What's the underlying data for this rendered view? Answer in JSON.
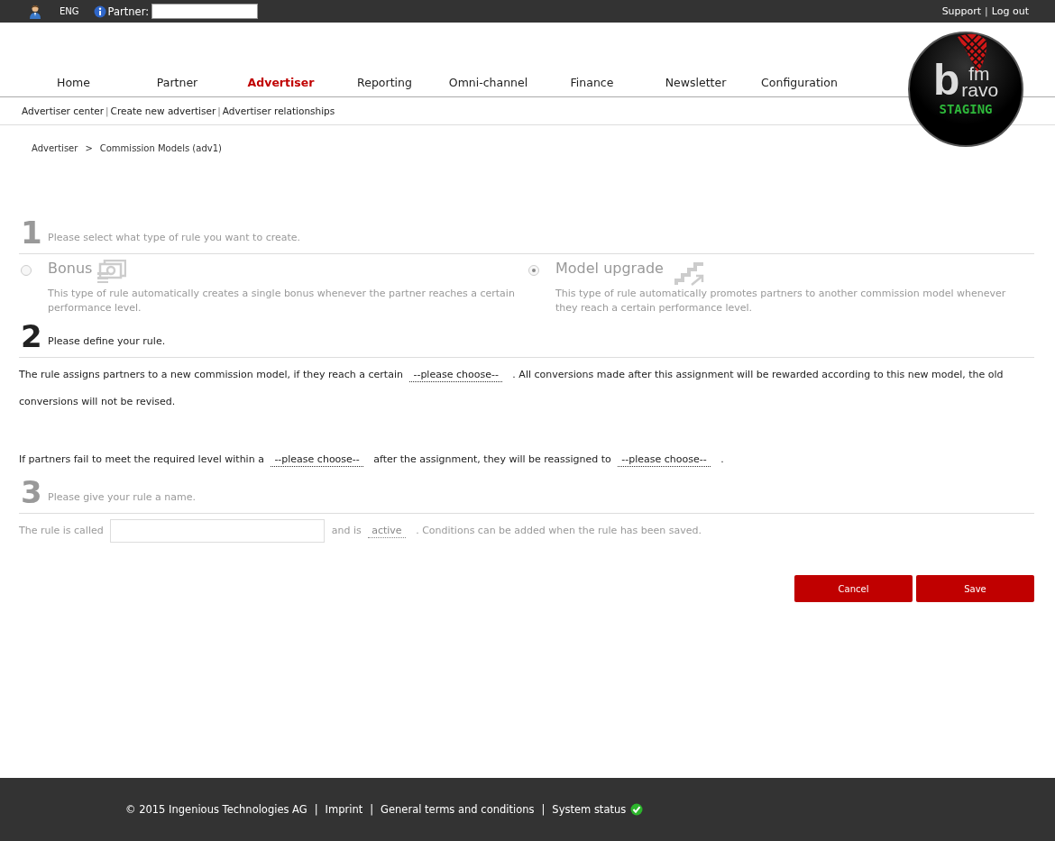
{
  "top_bar": {
    "language": "ENG",
    "partner_label": "Partner:",
    "links": [
      "Support",
      "Log out"
    ],
    "separator": "|"
  },
  "nav": {
    "items": [
      {
        "label": "Home",
        "selected": false
      },
      {
        "label": "Partner",
        "selected": false
      },
      {
        "label": "Advertiser",
        "selected": true
      },
      {
        "label": "Reporting",
        "selected": false
      },
      {
        "label": "Omni-channel",
        "selected": false
      },
      {
        "label": "Finance",
        "selected": false
      },
      {
        "label": "Newsletter",
        "selected": false
      },
      {
        "label": "Configuration",
        "selected": false
      }
    ]
  },
  "logo": {
    "letter": "b",
    "top": "fm",
    "bottom": "ravo",
    "label": "STAGING"
  },
  "subnav": {
    "items": [
      "Advertiser center",
      "Create new advertiser",
      "Advertiser relationships"
    ],
    "separator": "|"
  },
  "breadcrumb": {
    "items": [
      "Advertiser",
      "Commission Models (adv1)"
    ],
    "separator": ">"
  },
  "steps": [
    {
      "number": "1",
      "title": "Please select what type of rule you want to create.",
      "active": false,
      "options": [
        {
          "title": "Bonus",
          "description": "This type of rule automatically creates a single bonus whenever the partner reaches a certain performance level.",
          "selected": false
        },
        {
          "title": "Model upgrade",
          "description": "This type of rule automatically promotes partners to another commission model whenever they reach a certain performance level.",
          "selected": true
        }
      ]
    },
    {
      "number": "2",
      "title": "Please define your rule.",
      "active": true,
      "paragraphs": [
        [
          {
            "kind": "text",
            "text": "The rule assigns partners to a new commission model, if they reach a certain"
          },
          {
            "kind": "select",
            "text": "--please choose--"
          },
          {
            "kind": "text",
            "text": ". All conversions made after this assignment will be rewarded according to this new model, the old"
          },
          {
            "kind": "text",
            "text": "conversions will not be revised."
          }
        ],
        [
          {
            "kind": "text",
            "text": "If partners fail to meet the required level within a"
          },
          {
            "kind": "select",
            "text": "--please choose--"
          },
          {
            "kind": "text",
            "text": "after the assignment, they will be reassigned to"
          },
          {
            "kind": "select",
            "text": "--please choose--"
          },
          {
            "kind": "text",
            "text": "."
          }
        ]
      ]
    },
    {
      "number": "3",
      "title": "Please give your rule a name.",
      "active": false,
      "paragraphs": [
        [
          {
            "kind": "text",
            "text": "The rule is called"
          },
          {
            "kind": "input"
          },
          {
            "kind": "text",
            "text": "and is"
          },
          {
            "kind": "select",
            "text": "active"
          },
          {
            "kind": "text",
            "text": ". Conditions can be added when the rule has been saved."
          }
        ]
      ]
    }
  ],
  "buttons": [
    "Cancel",
    "Save"
  ],
  "footer": {
    "items": [
      {
        "kind": "text",
        "text": "© 2015 Ingenious Technologies AG"
      },
      {
        "kind": "link",
        "text": "Imprint"
      },
      {
        "kind": "link",
        "text": "General terms and conditions"
      },
      {
        "kind": "status",
        "text": "System status"
      }
    ],
    "separator": "|"
  }
}
